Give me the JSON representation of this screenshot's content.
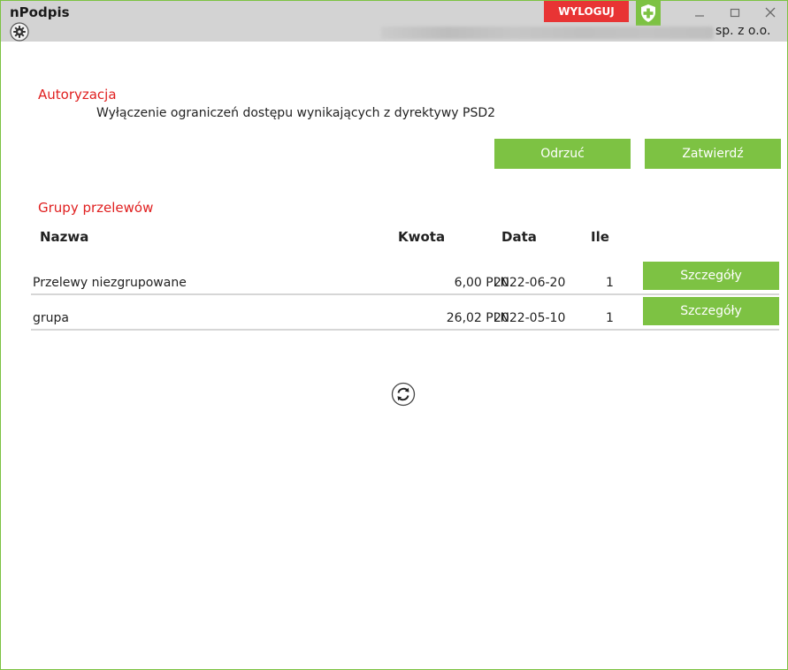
{
  "window": {
    "title": "nPodpis",
    "logout_label": "WYLOGUJ",
    "company_suffix": "sp. z o.o."
  },
  "colors": {
    "accent_green": "#7dc243",
    "logout_red": "#e83434",
    "section_red": "#e02020",
    "titlebar_gray": "#d3d3d3"
  },
  "icons": {
    "shield": "shield-icon",
    "gear": "gear-icon",
    "refresh": "refresh-icon",
    "minimize": "minimize-icon",
    "maximize": "maximize-icon",
    "close": "close-icon"
  },
  "authorization": {
    "title": "Autoryzacja",
    "description": "Wyłączenie ograniczeń dostępu wynikających z dyrektywy PSD2",
    "reject_label": "Odrzuć",
    "approve_label": "Zatwierdź"
  },
  "groups": {
    "title": "Grupy przelewów",
    "columns": {
      "name": "Nazwa",
      "amount": "Kwota",
      "date": "Data",
      "count": "Ile"
    },
    "rows": [
      {
        "name": "Przelewy niezgrupowane",
        "amount": "6,00 PLN",
        "date": "2022-06-20",
        "count": "1",
        "details_label": "Szczegóły"
      },
      {
        "name": "grupa",
        "amount": "26,02 PLN",
        "date": "2022-05-10",
        "count": "1",
        "details_label": "Szczegóły"
      }
    ]
  }
}
